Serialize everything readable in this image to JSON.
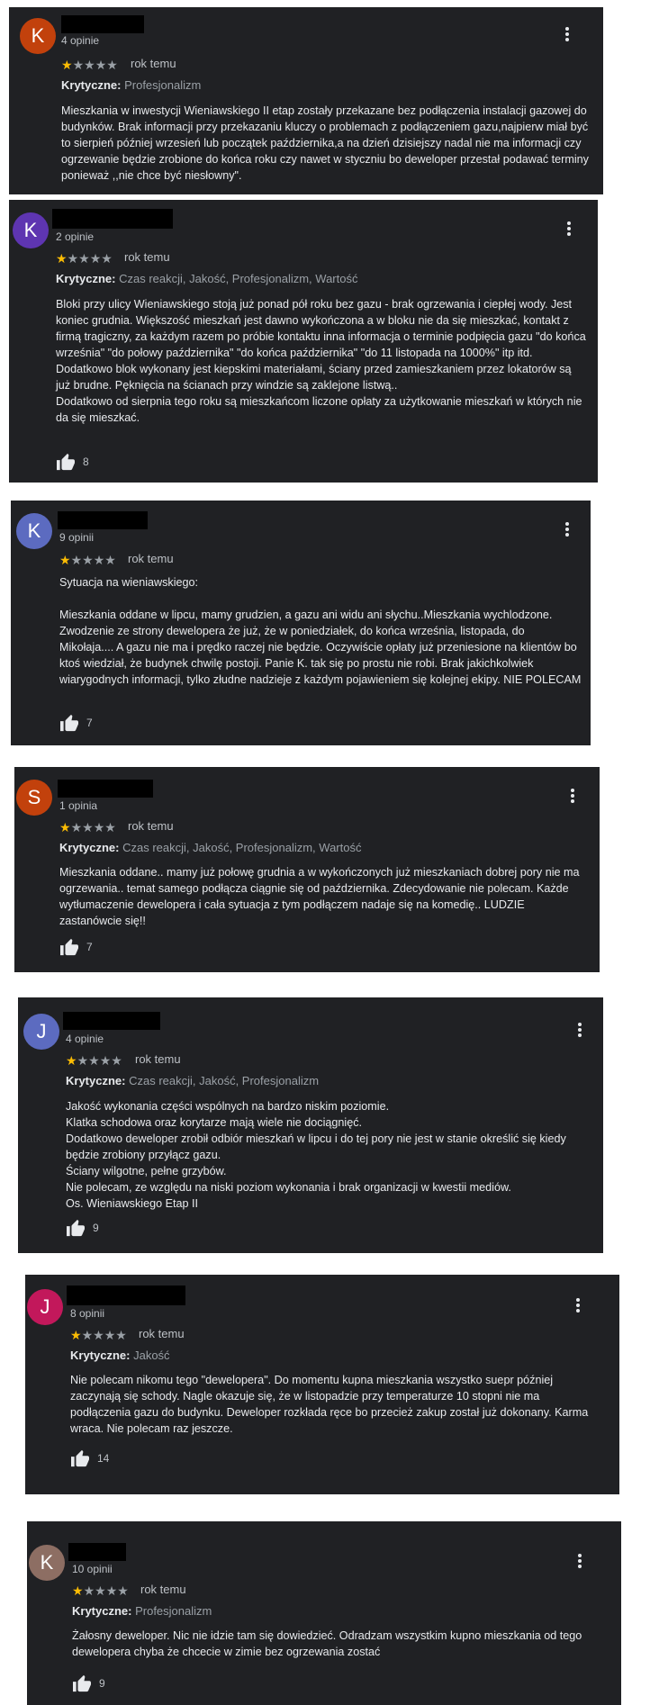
{
  "rating_star_on_color": "#fbbc04",
  "rating_star_off_color": "#9aa0a6",
  "reviews": [
    {
      "initial": "K",
      "avatar_color": "#c2410c",
      "reviewer_count": "4 opinie",
      "rating": 1,
      "time": "rok temu",
      "critical_label": "Krytyczne:",
      "critical_values": "Profesjonalizm",
      "text": "Mieszkania w inwestycji Wieniawskiego II etap zostały przekazane bez podłączenia instalacji gazowej do budynków. Brak informacji przy przekazaniu kluczy o problemach z podłączeniem gazu,najpierw miał być to sierpień później wrzesień lub początek października,a na dzień dzisiejszy nadal nie ma informacji czy ogrzewanie będzie zrobione do końca roku czy nawet w styczniu bo deweloper przestał podawać terminy ponieważ ,,nie chce być niesłowny\".",
      "likes": ""
    },
    {
      "initial": "K",
      "avatar_color": "#5e35b1",
      "reviewer_count": "2 opinie",
      "rating": 1,
      "time": "rok temu",
      "critical_label": "Krytyczne:",
      "critical_values": "Czas reakcji, Jakość, Profesjonalizm, Wartość",
      "text": "Bloki przy ulicy Wieniawskiego stoją już ponad pół roku bez gazu - brak ogrzewania i ciepłej wody. Jest koniec grudnia. Większość mieszkań jest dawno wykończona a w bloku nie da się mieszkać, kontakt z firmą tragiczny, za każdym razem po próbie kontaktu inna informacja o terminie podpięcia gazu \"do końca września\" \"do połowy października\" \"do końca października\" \"do 11 listopada na 1000%\" itp itd.\nDodatkowo blok wykonany jest kiepskimi materiałami, ściany przed zamieszkaniem przez lokatorów są już brudne. Pęknięcia na ścianach przy windzie są zaklejone listwą..\nDodatkowo od sierpnia tego roku są mieszkańcom liczone opłaty za użytkowanie mieszkań w których nie da się mieszkać.",
      "likes": "8"
    },
    {
      "initial": "K",
      "avatar_color": "#5c6bc0",
      "reviewer_count": "9 opinii",
      "rating": 1,
      "time": "rok temu",
      "critical_label": "",
      "critical_values": "",
      "text": "Sytuacja na wieniawskiego:\n\nMieszkania oddane w lipcu, mamy grudzien, a gazu ani widu ani słychu..Mieszkania wychlodzone. Zwodzenie ze strony dewelopera że już, że w poniedziałek, do końca września, listopada, do Mikołaja.... A gazu nie ma i prędko raczej nie będzie. Oczywiście opłaty już przeniesione na klientów bo ktoś wiedział, że budynek chwilę postoji. Panie K. tak się po prostu nie robi. Brak jakichkolwiek wiarygodnych informacji, tylko złudne nadzieje z każdym pojawieniem się kolejnej ekipy. NIE POLECAM",
      "likes": "7"
    },
    {
      "initial": "S",
      "avatar_color": "#c2410c",
      "reviewer_count": "1 opinia",
      "rating": 1,
      "time": "rok temu",
      "critical_label": "Krytyczne:",
      "critical_values": "Czas reakcji, Jakość, Profesjonalizm, Wartość",
      "text": "Mieszkania oddane.. mamy już połowę grudnia a w wykończonych już mieszkaniach dobrej pory nie ma ogrzewania.. temat samego podłącza ciągnie się od października. Zdecydowanie nie polecam. Każde wytłumaczenie dewelopera i cała sytuacja z tym podłączem nadaje się na komedię.. LUDZIE zastanówcie się!!",
      "likes": "7"
    },
    {
      "initial": "J",
      "avatar_color": "#5c6bc0",
      "reviewer_count": "4 opinie",
      "rating": 1,
      "time": "rok temu",
      "critical_label": "Krytyczne:",
      "critical_values": "Czas reakcji, Jakość, Profesjonalizm",
      "text": "Jakość wykonania części wspólnych na bardzo niskim poziomie.\nKlatka schodowa oraz korytarze mają wiele nie dociągnięć.\nDodatkowo deweloper zrobił odbiór mieszkań w lipcu i do tej pory nie jest w stanie określić się kiedy będzie zrobiony przyłącz gazu.\nŚciany wilgotne, pełne grzybów.\nNie polecam, ze względu na niski poziom wykonania i brak organizacji w kwestii mediów.\nOs. Wieniawskiego Etap II",
      "likes": "9"
    },
    {
      "initial": "J",
      "avatar_color": "#c2185b",
      "reviewer_count": "8 opinii",
      "rating": 1,
      "time": "rok temu",
      "critical_label": "Krytyczne:",
      "critical_values": "Jakość",
      "text": "Nie polecam nikomu tego \"dewelopera\". Do momentu kupna mieszkania wszystko suepr później zaczynają się schody. Nagle okazuje się, że w listopadzie przy temperaturze 10 stopni nie ma podłączenia gazu do budynku. Deweloper rozkłada ręce bo przecież zakup został już dokonany. Karma wraca. Nie polecam raz jeszcze.",
      "likes": "14"
    },
    {
      "initial": "K",
      "avatar_color": "#8d6e63",
      "reviewer_count": "10 opinii",
      "rating": 1,
      "time": "rok temu",
      "critical_label": "Krytyczne:",
      "critical_values": "Profesjonalizm",
      "text": "Żałosny deweloper. Nic nie idzie tam się dowiedzieć. Odradzam wszystkim kupno mieszkania od tego dewelopera chyba że chcecie w zimie bez ogrzewania zostać",
      "likes": "9"
    }
  ]
}
